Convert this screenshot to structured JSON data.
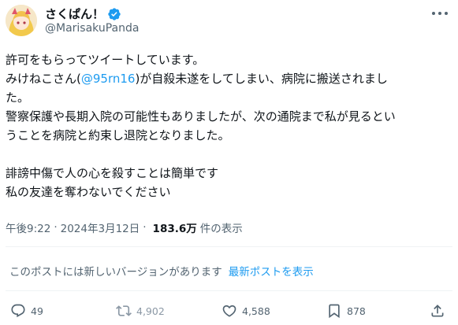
{
  "user": {
    "display_name": "さくぱん！",
    "handle": "@MarisakuPanda"
  },
  "tweet": {
    "line1": "許可をもらってツイートしています。",
    "line2_pre": "みけねこさん(",
    "line2_mention": "@95rn16",
    "line2_post": ")が自殺未遂をしてしまい、病院に搬送されまし",
    "line3": "た。",
    "line4": "警察保護や長期入院の可能性もありましたが、次の通院まで私が見るとい",
    "line5": "うことを病院と約束し退院となりました。",
    "line6": "誹謗中傷で人の心を殺すことは簡単です",
    "line7": "私の友達を奪わないでください"
  },
  "meta": {
    "time": "午後9:22",
    "date": "2024年3月12日",
    "views_count": "183.6万",
    "views_label": "件の表示"
  },
  "notice": {
    "text": "このポストには新しいバージョンがあります",
    "link": "最新ポストを表示"
  },
  "actions": {
    "replies": "49",
    "retweets": "4,902",
    "likes": "4,588",
    "bookmarks": "878"
  },
  "colors": {
    "accent": "#1d9bf0",
    "text": "#0f1419",
    "secondary": "#536471"
  }
}
